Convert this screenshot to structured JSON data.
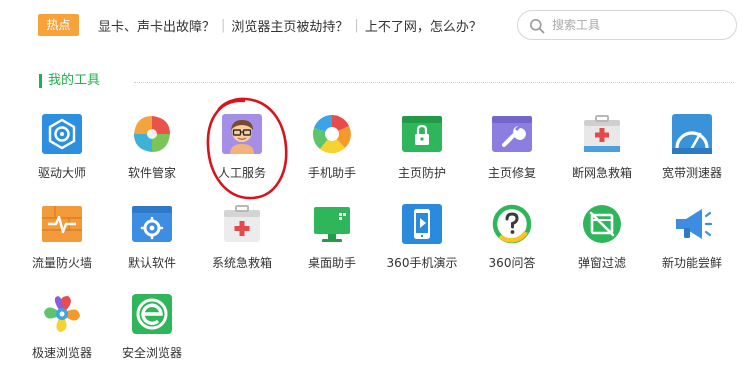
{
  "hot": {
    "badge": "热点",
    "links": [
      "显卡、声卡出故障？",
      "浏览器主页被劫持？",
      "上不了网，怎么办？"
    ]
  },
  "search": {
    "placeholder": "搜索工具",
    "value": ""
  },
  "section": {
    "title": "我的工具"
  },
  "tools": [
    {
      "label": "驱动大师",
      "icon": "driver-master-icon"
    },
    {
      "label": "软件管家",
      "icon": "software-manager-icon"
    },
    {
      "label": "人工服务",
      "icon": "manual-service-icon"
    },
    {
      "label": "手机助手",
      "icon": "phone-assistant-icon"
    },
    {
      "label": "主页防护",
      "icon": "homepage-protect-icon"
    },
    {
      "label": "主页修复",
      "icon": "homepage-repair-icon"
    },
    {
      "label": "断网急救箱",
      "icon": "network-first-aid-icon"
    },
    {
      "label": "宽带测速器",
      "icon": "broadband-speed-icon"
    },
    {
      "label": "流量防火墙",
      "icon": "traffic-firewall-icon"
    },
    {
      "label": "默认软件",
      "icon": "default-software-icon"
    },
    {
      "label": "系统急救箱",
      "icon": "system-first-aid-icon"
    },
    {
      "label": "桌面助手",
      "icon": "desktop-assistant-icon"
    },
    {
      "label": "360手机演示",
      "icon": "phone-demo-icon"
    },
    {
      "label": "360问答",
      "icon": "qa-icon"
    },
    {
      "label": "弹窗过滤",
      "icon": "popup-filter-icon"
    },
    {
      "label": "新功能尝鲜",
      "icon": "new-feature-icon"
    },
    {
      "label": "极速浏览器",
      "icon": "speed-browser-icon"
    },
    {
      "label": "安全浏览器",
      "icon": "safe-browser-icon"
    }
  ],
  "colors": {
    "accent": "#1fb14a",
    "hot_badge": "#f8a23a",
    "annotation": "#d8141a"
  }
}
